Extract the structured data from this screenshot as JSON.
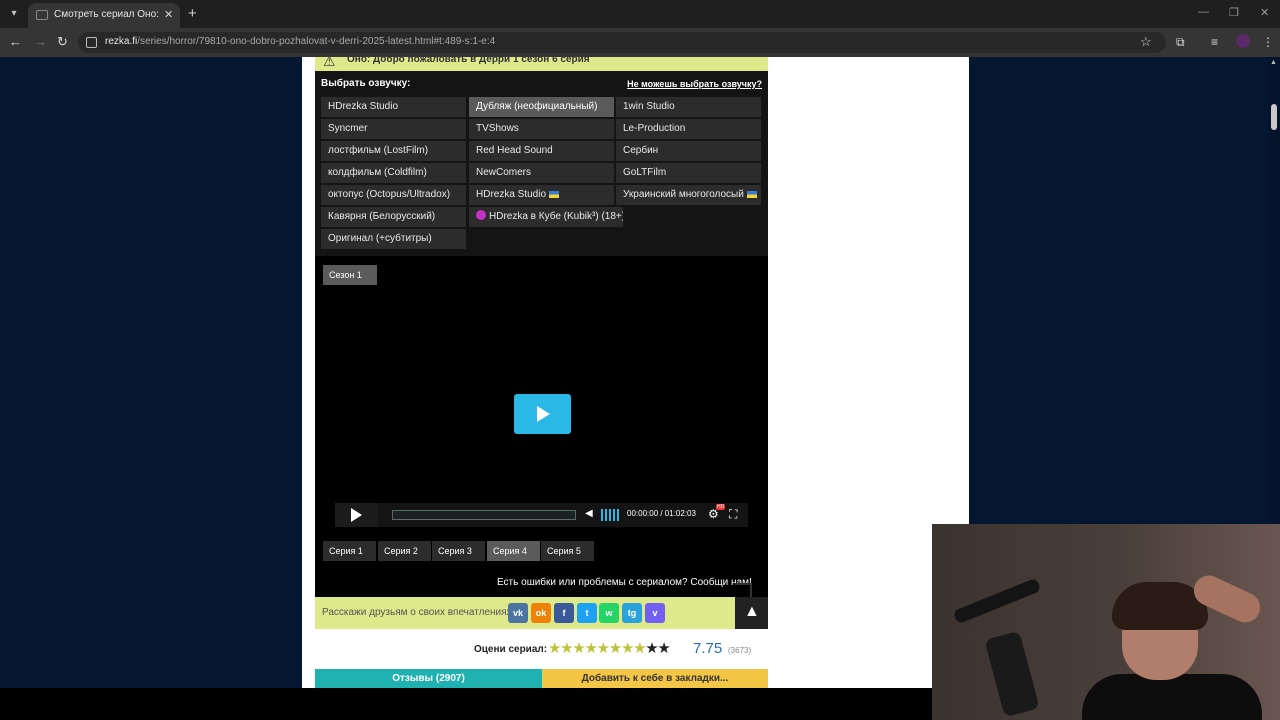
{
  "browser": {
    "tab_title": "Смотреть сериал Оно: Добро",
    "url_host": "rezka.fi",
    "url_path": "/series/horror/79810-ono-dobro-pozhalovat-v-derri-2025-latest.html#t:489-s:1-e:4"
  },
  "page": {
    "warning_text": "Оно: Добро пожаловать в Дерри 1 сезон 6 серия",
    "dub_title": "Выбрать озвучку:",
    "dub_help": "Не можешь выбрать озвучку?",
    "dubs": [
      "HDrezka Studio",
      "Дубляж (неофициальный)",
      "1win Studio",
      "Syncmer",
      "TVShows",
      "Le-Production",
      "лостфильм (LostFilm)",
      "Red Head Sound",
      "Сербин",
      "колдфильм (Coldfilm)",
      "NewComers",
      "GoLTFilm",
      "октопус (Octopus/Ultradox)",
      "HDrezka Studio",
      "Украинский многоголосый",
      "Кавярня (Белорусский)",
      "HDrezka в Кубе (Kubik³) (18+)",
      "Оригинал (+субтитры)"
    ],
    "season": "Сезон 1",
    "time": "00:00:00 / 01:02:03",
    "episodes": [
      "Серия 1",
      "Серия 2",
      "Серия 3",
      "Серия 4",
      "Серия 5"
    ],
    "active_episode": "Серия 4",
    "report_text": "Есть ошибки или проблемы с сериалом? Сообщи нам!",
    "share_label": "Расскажи друзьям о своих впечатлениях:",
    "social": [
      {
        "name": "vk",
        "label": "vk",
        "color": "#4c75a3"
      },
      {
        "name": "ok",
        "label": "ok",
        "color": "#ee8208"
      },
      {
        "name": "facebook",
        "label": "f",
        "color": "#3b5998"
      },
      {
        "name": "twitter",
        "label": "t",
        "color": "#1da1f2"
      },
      {
        "name": "whatsapp",
        "label": "w",
        "color": "#25d366"
      },
      {
        "name": "telegram",
        "label": "tg",
        "color": "#2aa3dd"
      },
      {
        "name": "viber",
        "label": "v",
        "color": "#7360f2"
      }
    ],
    "rate_label": "Оцени сериал:",
    "rating": "7.75",
    "rating_count": "(3673)",
    "stars_filled": 8,
    "stars_total": 10,
    "reviews_btn": "Отзывы (2907)",
    "bookmark_btn": "Добавить к себе в закладки..."
  },
  "colors": {
    "accent_blue": "#2ab8e6",
    "yellow_green": "#dde98a",
    "teal": "#20b2b0",
    "gold": "#f3c645"
  }
}
